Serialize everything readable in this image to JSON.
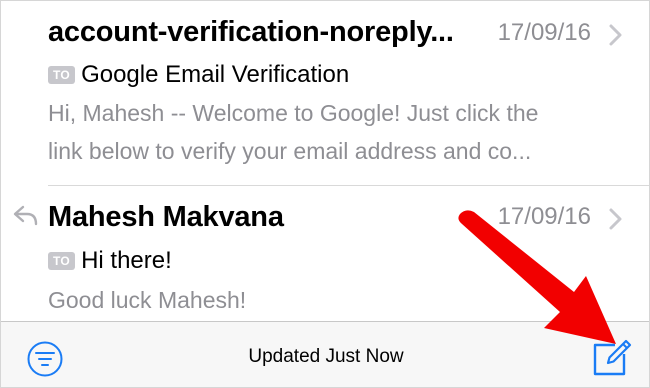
{
  "mail_list": [
    {
      "sender": "account-verification-noreply...",
      "date": "17/09/16",
      "to_badge": "TO",
      "subject": "Google Email Verification",
      "preview_line_1": "Hi, Mahesh -- Welcome to Google! Just click the",
      "preview_line_2": "link below to verify your email address and co..."
    },
    {
      "sender": "Mahesh Makvana",
      "date": "17/09/16",
      "to_badge": "TO",
      "subject": "Hi there!",
      "preview_line_1": "Good luck Mahesh!",
      "replied": true
    }
  ],
  "toolbar": {
    "status": "Updated Just Now",
    "filter_icon": "filter-icon",
    "compose_icon": "compose-icon"
  },
  "colors": {
    "accent": "#1a7cf5",
    "secondary_text": "#8e8e93",
    "annotation_arrow": "#f20000"
  }
}
